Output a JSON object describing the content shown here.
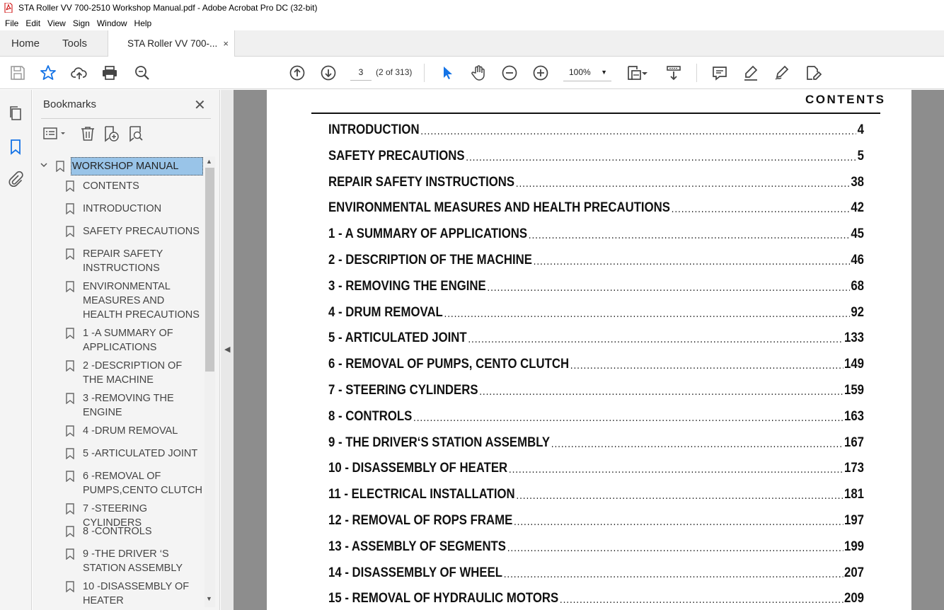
{
  "window": {
    "title": "STA Roller VV 700-2510 Workshop Manual.pdf - Adobe Acrobat Pro DC (32-bit)"
  },
  "menu": [
    "File",
    "Edit",
    "View",
    "Sign",
    "Window",
    "Help"
  ],
  "tabs": {
    "home": "Home",
    "tools": "Tools",
    "document": "STA Roller VV 700-...",
    "close": "×"
  },
  "toolbar": {
    "page_number": "3",
    "page_count": "(2 of 313)",
    "zoom": "100%",
    "zoom_dropdown": "▼"
  },
  "bookmarks": {
    "header": "Bookmarks",
    "close": "✕",
    "root": "WORKSHOP MANUAL",
    "items": [
      "CONTENTS",
      "INTRODUCTION",
      "SAFETY PRECAUTIONS",
      "REPAIR SAFETY INSTRUCTIONS",
      "ENVIRONMENTAL MEASURES AND HEALTH PRECAUTIONS",
      "1 -A SUMMARY OF APPLICATIONS",
      "2 -DESCRIPTION OF THE MACHINE",
      "3 -REMOVING THE ENGINE",
      "4 -DRUM REMOVAL",
      "5 -ARTICULATED JOINT",
      "6 -REMOVAL OF PUMPS,CENTO CLUTCH",
      "7 -STEERING CYLINDERS",
      "8 -CONTROLS",
      "9 -THE DRIVER ‘S STATION ASSEMBLY",
      "10 -DISASSEMBLY OF HEATER"
    ]
  },
  "document": {
    "heading": "CONTENTS",
    "toc": [
      {
        "title": "INTRODUCTION",
        "page": "4"
      },
      {
        "title": "SAFETY PRECAUTIONS",
        "page": "5"
      },
      {
        "title": "REPAIR SAFETY INSTRUCTIONS",
        "page": "38"
      },
      {
        "title": "ENVIRONMENTAL MEASURES AND HEALTH PRECAUTIONS",
        "page": "42"
      },
      {
        "title": "1 - A SUMMARY OF APPLICATIONS",
        "page": "45"
      },
      {
        "title": "2 - DESCRIPTION OF THE MACHINE",
        "page": "46"
      },
      {
        "title": "3 - REMOVING THE ENGINE",
        "page": "68"
      },
      {
        "title": "4 - DRUM REMOVAL",
        "page": "92"
      },
      {
        "title": "5 - ARTICULATED JOINT",
        "page": "133"
      },
      {
        "title": "6 - REMOVAL OF PUMPS, CENTO CLUTCH",
        "page": "149"
      },
      {
        "title": "7 - STEERING CYLINDERS",
        "page": "159"
      },
      {
        "title": "8 - CONTROLS",
        "page": "163"
      },
      {
        "title": "9 - THE DRIVER‘S STATION ASSEMBLY",
        "page": "167"
      },
      {
        "title": "10 - DISASSEMBLY OF HEATER",
        "page": "173"
      },
      {
        "title": "11 - ELECTRICAL INSTALLATION",
        "page": "181"
      },
      {
        "title": "12 - REMOVAL OF ROPS FRAME",
        "page": "197"
      },
      {
        "title": "13 - ASSEMBLY OF SEGMENTS",
        "page": "199"
      },
      {
        "title": "14 - DISASSEMBLY OF WHEEL",
        "page": "207"
      },
      {
        "title": "15 - REMOVAL OF HYDRAULIC MOTORS",
        "page": "209"
      }
    ]
  },
  "colors": {
    "accent": "#1473e6",
    "selection": "#99c4e8",
    "doc_background": "#8d8d8d"
  }
}
